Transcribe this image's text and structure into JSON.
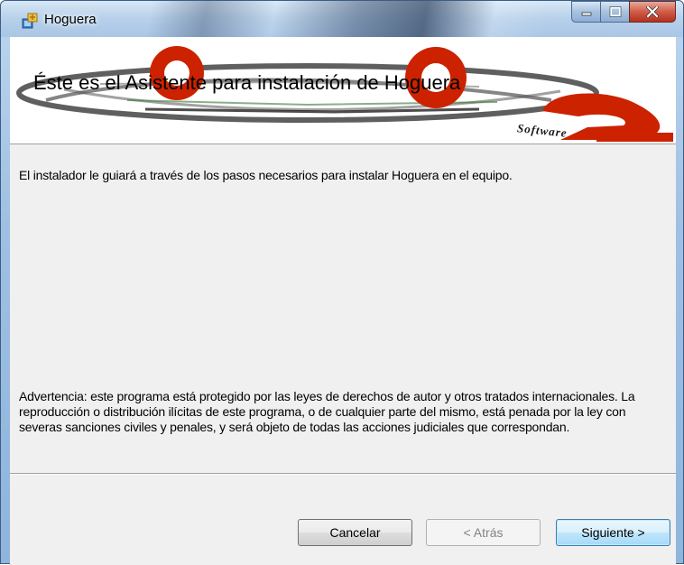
{
  "window": {
    "title": "Hoguera",
    "icon": "installer-icon",
    "controls": {
      "minimize": "minimize-icon",
      "maximize": "maximize-icon",
      "close": "close-icon"
    }
  },
  "banner": {
    "heading": "Éste es el Asistente para instalación de Hoguera",
    "logo_text": "Software"
  },
  "body": {
    "intro": "El instalador le guiará a través de los pasos necesarios para instalar Hoguera en el equipo.",
    "warning": "Advertencia: este programa está protegido por las leyes de derechos de autor y otros tratados internacionales. La reproducción o distribución ilícitas de este programa, o de cualquier parte del mismo, está penada por la ley con severas sanciones civiles y penales, y será objeto de todas las acciones judiciales que correspondan."
  },
  "buttons": {
    "cancel": "Cancelar",
    "back": "< Atrás",
    "next": "Siguiente >"
  },
  "colors": {
    "logo_red": "#cc2200",
    "client_bg": "#f0f0f0",
    "disabled_text": "#838383"
  }
}
